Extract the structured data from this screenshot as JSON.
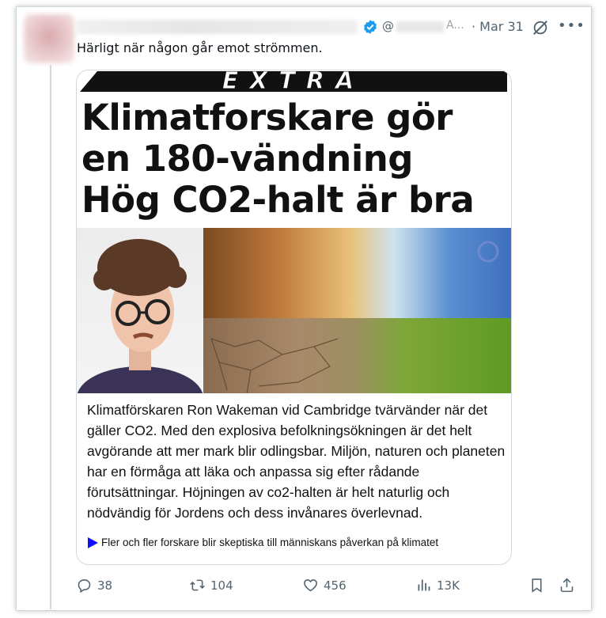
{
  "tweet": {
    "handle_prefix": "@",
    "handle_suffix": "A...",
    "date": "· Mar 31",
    "text": "Härligt när någon går emot strömmen."
  },
  "media": {
    "banner": "EXTRA",
    "headline": [
      "Klimatforskare gör",
      "en 180-vändning",
      "Hög CO2-halt är bra"
    ],
    "article": "Klimatförskaren Ron Wakeman vid Cambridge tvärvänder när det gäller CO2. Med den explosiva befolkningsökningen är det helt avgörande att mer mark blir odlingsbar. Miljön, naturen och planeten har en förmåga att läka och anpassa sig efter rådande förutsättningar. Höjningen av co2-halten är helt naturlig och nödvändig för Jordens och dess invånares överlevnad.",
    "footer": "Fler och fler forskare blir skeptiska till människans påverkan på klimatet"
  },
  "actions": {
    "replies": "38",
    "reposts": "104",
    "likes": "456",
    "views": "13K"
  },
  "icons": [
    "verified-badge-icon",
    "grok-icon",
    "more-icon",
    "reply-icon",
    "repost-icon",
    "like-icon",
    "views-icon",
    "bookmark-icon",
    "share-icon"
  ],
  "colors": {
    "verified": "#1d9bf0",
    "muted": "#536471",
    "link_triangle": "#1010ff"
  }
}
